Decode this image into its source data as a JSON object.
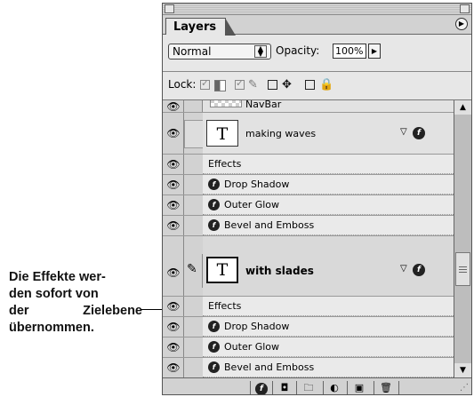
{
  "caption": {
    "line1": "Die Effekte wer-",
    "line2": "den sofort von",
    "line3": "der Zielebene",
    "line4": "übernommen."
  },
  "panel": {
    "tab_label": "Layers",
    "blend_mode": "Normal",
    "opacity_label": "Opacity:",
    "opacity_value": "100%",
    "lock_label": "Lock:"
  },
  "layers": {
    "navbar_name": "NavBar",
    "layer1": {
      "name": "making waves",
      "thumb": "T",
      "effects_label": "Effects",
      "effects": [
        "Drop Shadow",
        "Outer Glow",
        "Bevel and Emboss"
      ]
    },
    "layer2": {
      "name": "with slades",
      "thumb": "T",
      "effects_label": "Effects",
      "effects": [
        "Drop Shadow",
        "Outer Glow",
        "Bevel and Emboss"
      ]
    }
  },
  "icons": {
    "eye": "👁",
    "fx": "f",
    "brush": "✎",
    "menu": "▶",
    "triangle": "▽"
  }
}
